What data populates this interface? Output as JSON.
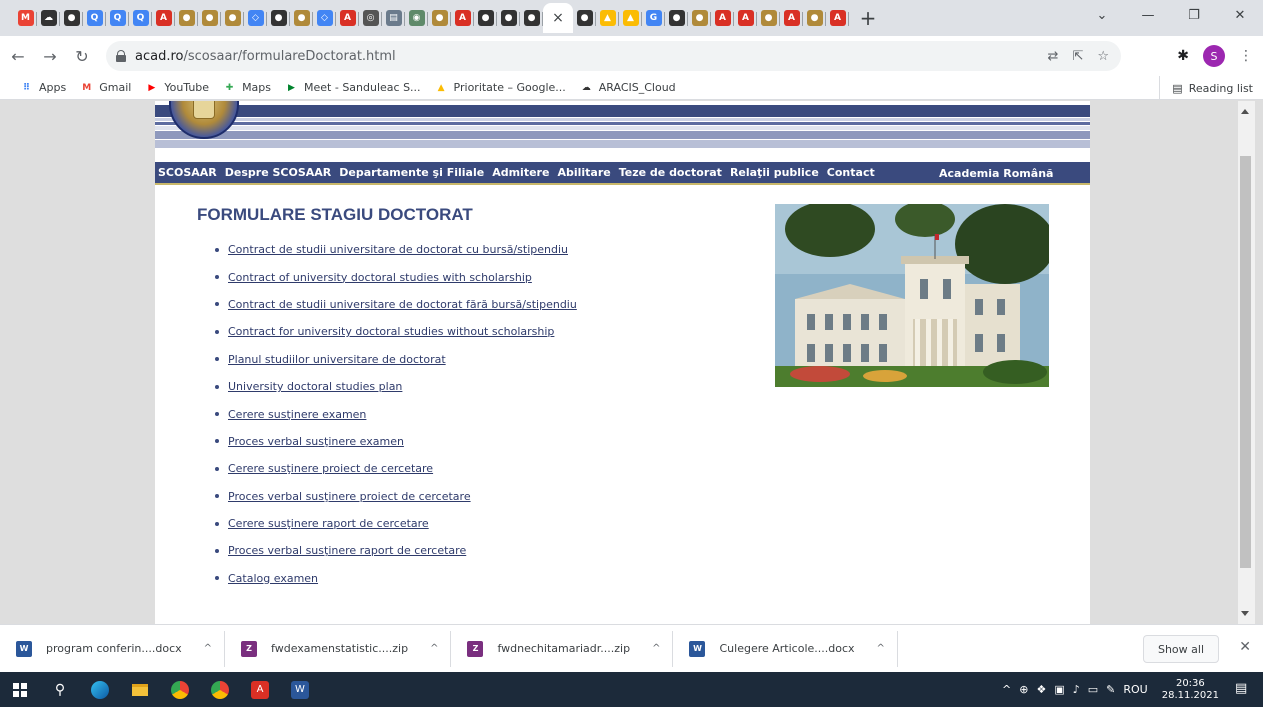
{
  "browser": {
    "tabs": [
      {
        "icon": "gmail-icon",
        "glyph": "M",
        "color": "#ea4335"
      },
      {
        "icon": "cloud-icon",
        "glyph": "☁",
        "color": "#333333"
      },
      {
        "icon": "chrome-icon",
        "glyph": "●",
        "color": "#333333"
      },
      {
        "icon": "search-icon",
        "glyph": "Q",
        "color": "#4285f4"
      },
      {
        "icon": "search-icon",
        "glyph": "Q",
        "color": "#4285f4"
      },
      {
        "icon": "search-icon",
        "glyph": "Q",
        "color": "#4285f4"
      },
      {
        "icon": "pdf-icon",
        "glyph": "A",
        "color": "#d93025"
      },
      {
        "icon": "academy-icon",
        "glyph": "●",
        "color": "#b08a3a"
      },
      {
        "icon": "academy-icon",
        "glyph": "●",
        "color": "#b08a3a"
      },
      {
        "icon": "academy-icon",
        "glyph": "●",
        "color": "#b08a3a"
      },
      {
        "icon": "diamond-icon",
        "glyph": "◇",
        "color": "#4285f4"
      },
      {
        "icon": "chrome-icon",
        "glyph": "●",
        "color": "#333333"
      },
      {
        "icon": "academy-icon",
        "glyph": "●",
        "color": "#b08a3a"
      },
      {
        "icon": "diamond-icon",
        "glyph": "◇",
        "color": "#4285f4"
      },
      {
        "icon": "pdf-icon",
        "glyph": "A",
        "color": "#d93025"
      },
      {
        "icon": "circle-icon",
        "glyph": "◎",
        "color": "#555555"
      },
      {
        "icon": "doc-icon",
        "glyph": "▤",
        "color": "#6b7b8c"
      },
      {
        "icon": "seal-icon",
        "glyph": "◉",
        "color": "#5f8a6a"
      },
      {
        "icon": "academy-icon",
        "glyph": "●",
        "color": "#b08a3a"
      },
      {
        "icon": "pdf-icon",
        "glyph": "A",
        "color": "#d93025"
      },
      {
        "icon": "chrome-icon",
        "glyph": "●",
        "color": "#333333"
      },
      {
        "icon": "chrome-icon",
        "glyph": "●",
        "color": "#333333"
      },
      {
        "icon": "chrome-icon",
        "glyph": "●",
        "color": "#333333"
      },
      {
        "icon": "close-icon",
        "glyph": "×",
        "color": "#ffffff",
        "active": true
      },
      {
        "icon": "chrome-icon",
        "glyph": "●",
        "color": "#333333"
      },
      {
        "icon": "drive-icon",
        "glyph": "▲",
        "color": "#fbbc04"
      },
      {
        "icon": "drive-icon",
        "glyph": "▲",
        "color": "#fbbc04"
      },
      {
        "icon": "google-icon",
        "glyph": "G",
        "color": "#4285f4"
      },
      {
        "icon": "chrome-icon",
        "glyph": "●",
        "color": "#333333"
      },
      {
        "icon": "academy-icon",
        "glyph": "●",
        "color": "#b08a3a"
      },
      {
        "icon": "pdf-icon",
        "glyph": "A",
        "color": "#d93025"
      },
      {
        "icon": "pdf-icon",
        "glyph": "A",
        "color": "#d93025"
      },
      {
        "icon": "academy-icon",
        "glyph": "●",
        "color": "#b08a3a"
      },
      {
        "icon": "pdf-icon",
        "glyph": "A",
        "color": "#d93025"
      },
      {
        "icon": "academy-icon",
        "glyph": "●",
        "color": "#b08a3a"
      },
      {
        "icon": "pdf-icon",
        "glyph": "A",
        "color": "#d93025"
      }
    ],
    "new_tab": "+",
    "url_host": "acad.ro",
    "url_path": "/scosaar/formulareDoctorat.html",
    "profile_initial": "S",
    "bookmarks": [
      {
        "label": "Apps",
        "icon": "apps-icon",
        "glyph": "⠿",
        "color": "#4285f4"
      },
      {
        "label": "Gmail",
        "icon": "gmail-icon",
        "glyph": "M",
        "color": "#ea4335"
      },
      {
        "label": "YouTube",
        "icon": "youtube-icon",
        "glyph": "▶",
        "color": "#ff0000"
      },
      {
        "label": "Maps",
        "icon": "maps-icon",
        "glyph": "✚",
        "color": "#34a853"
      },
      {
        "label": "Meet - Sanduleac S...",
        "icon": "meet-icon",
        "glyph": "▶",
        "color": "#00832d"
      },
      {
        "label": "Prioritate – Google...",
        "icon": "drive-icon",
        "glyph": "▲",
        "color": "#fbbc04"
      },
      {
        "label": "ARACIS_Cloud",
        "icon": "cloud-icon",
        "glyph": "☁",
        "color": "#333333"
      }
    ],
    "reading_list": "Reading list"
  },
  "site": {
    "nav": [
      "SCOSAAR",
      "Despre SCOSAAR",
      "Departamente şi Filiale",
      "Admitere",
      "Abilitare",
      "Teze de doctorat",
      "Relaţii publice",
      "Contact"
    ],
    "nav_right": "Academia Română",
    "title": "FORMULARE STAGIU DOCTORAT",
    "links": [
      "Contract de studii universitare de doctorat cu bursă/stipendiu",
      "Contract of university doctoral studies with scholarship",
      "Contract de studii universitare de doctorat fără bursă/stipendiu",
      "Contract for university doctoral studies without scholarship",
      "Planul studiilor universitare de doctorat",
      "University doctoral studies plan",
      "Cerere susţinere examen",
      "Proces verbal susţinere examen",
      "Cerere susţinere proiect de cercetare",
      "Proces verbal susţinere proiect de cercetare",
      "Cerere susţinere raport de cercetare",
      "Proces verbal susţinere raport de cercetare",
      "Catalog examen"
    ]
  },
  "downloads": {
    "items": [
      {
        "name": "program conferin....docx",
        "icon": "word-icon",
        "color": "#2b579a",
        "glyph": "W"
      },
      {
        "name": "fwdexamenstatistic....zip",
        "icon": "archive-icon",
        "color": "#7a2f7f",
        "glyph": "Z"
      },
      {
        "name": "fwdnechitamariadr....zip",
        "icon": "archive-icon",
        "color": "#7a2f7f",
        "glyph": "Z"
      },
      {
        "name": "Culegere Articole....docx",
        "icon": "word-icon",
        "color": "#2b579a",
        "glyph": "W"
      }
    ],
    "show_all": "Show all"
  },
  "taskbar": {
    "language": "ROU",
    "time": "20:36",
    "date": "28.11.2021"
  }
}
